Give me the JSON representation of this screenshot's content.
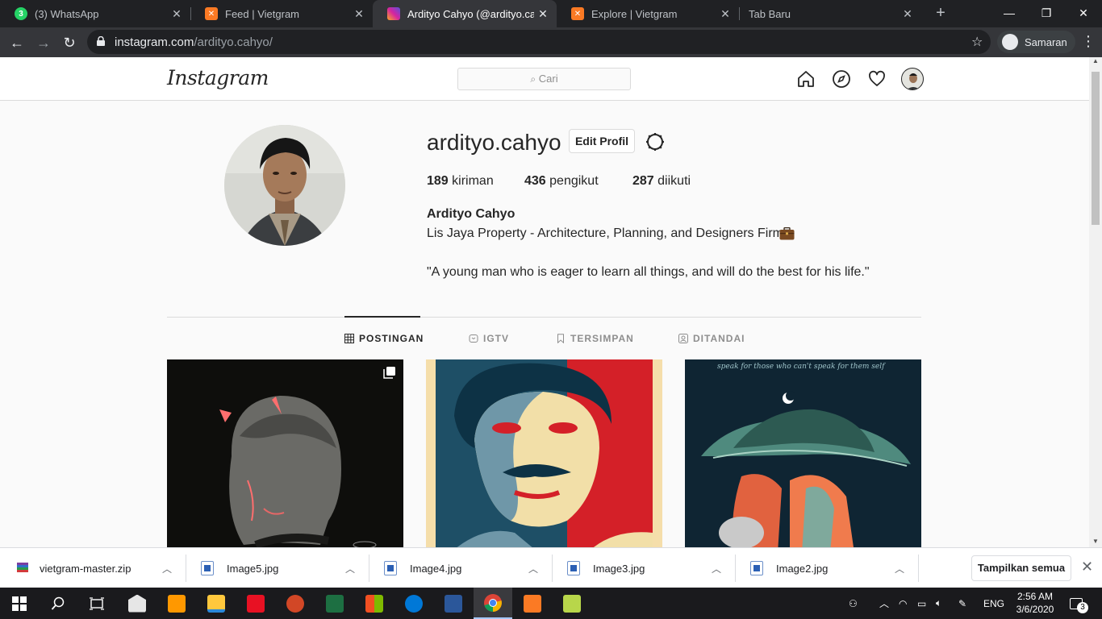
{
  "browser": {
    "tabs": [
      {
        "title": "(3) WhatsApp",
        "favicon": "whatsapp-icon",
        "color": "#25d366"
      },
      {
        "title": "Feed | Vietgram",
        "favicon": "xampp-icon",
        "color": "#fb7a24"
      },
      {
        "title": "Ardityo Cahyo (@ardityo.cahyo)",
        "favicon": "instagram-icon",
        "color": "#d6249f"
      },
      {
        "title": "Explore | Vietgram",
        "favicon": "xampp-icon",
        "color": "#fb7a24"
      },
      {
        "title": "Tab Baru",
        "favicon": "",
        "color": ""
      }
    ],
    "url_host": "instagram.com",
    "url_path": "/ardityo.cahyo/",
    "profile_label": "Samaran"
  },
  "instagram": {
    "logo": "Instagram",
    "search_placeholder": "Cari",
    "username": "ardityo.cahyo",
    "edit_label": "Edit Profil",
    "stats": [
      {
        "count": "189",
        "label": "kiriman"
      },
      {
        "count": "436",
        "label": "pengikut"
      },
      {
        "count": "287",
        "label": "diikuti"
      }
    ],
    "full_name": "Ardityo Cahyo",
    "bio_line1": "Lis Jaya Property - Architecture, Planning, and Designers Firm",
    "bio_line2": "\"A young man who is eager to learn all things, and will do the best for his life.\"",
    "tabs": [
      "POSTINGAN",
      "IGTV",
      "TERSIMPAN",
      "DITANDAI"
    ],
    "post3_caption": "speak for those who can't speak for them self"
  },
  "downloads": {
    "items": [
      "vietgram-master.zip",
      "Image5.jpg",
      "Image4.jpg",
      "Image3.jpg",
      "Image2.jpg"
    ],
    "show_all": "Tampilkan semua"
  },
  "taskbar": {
    "lang": "ENG",
    "time": "2:56 AM",
    "date": "3/6/2020",
    "notifications": "3"
  }
}
